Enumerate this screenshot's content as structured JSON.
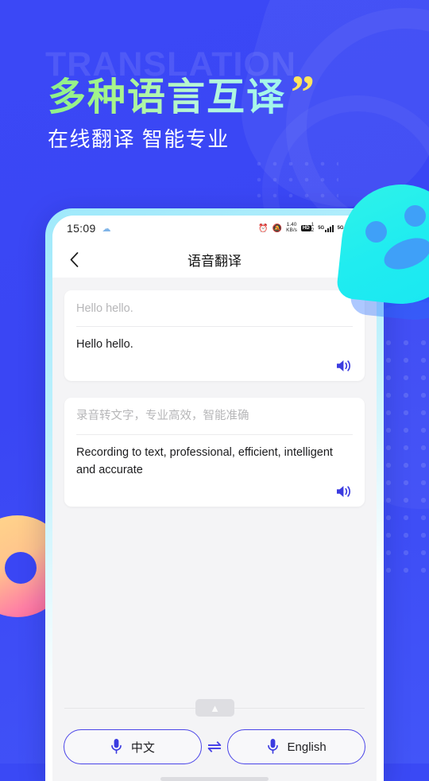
{
  "promo": {
    "watermark": "TRANSLATION",
    "headline": "多种语言互译",
    "quote_mark": "”",
    "subhead": "在线翻译 智能专业"
  },
  "phone": {
    "statusbar": {
      "time": "15:09",
      "left_icon": "cloud-sync-icon",
      "alarm_icon": "alarm-clock-icon",
      "mute_icon": "bell-muted-icon",
      "net_speed_value": "1.40",
      "net_speed_unit": "KB/s",
      "hd_badge": "HD",
      "hd_sub": "1",
      "hd_sub2": "2",
      "sim1_label": "5G",
      "sim2_label": "5G",
      "wifi_icon": "wifi-icon"
    },
    "navbar": {
      "back_icon": "chevron-left-icon",
      "title": "语音翻译"
    },
    "cards": [
      {
        "source": "Hello hello.",
        "translation": "Hello hello.",
        "speaker_icon": "speaker-icon"
      },
      {
        "source": "录音转文字，专业高效，智能准确",
        "translation": "Recording to text, professional, efficient, intelligent and accurate",
        "speaker_icon": "speaker-icon"
      }
    ],
    "collapse": {
      "icon": "chevron-double-up-icon"
    },
    "bottom": {
      "left_lang": "中文",
      "right_lang": "English",
      "left_mic_icon": "microphone-icon",
      "right_mic_icon": "microphone-icon",
      "swap_icon": "swap-arrows-icon",
      "swap_glyph": "⇌"
    }
  },
  "colors": {
    "background_blue": "#3a46f4",
    "accent_indigo": "#4a44e8",
    "headline_green": "#8cf08a",
    "quote_yellow": "#ffe45e",
    "bubble_cyan": "#2ff3e8"
  }
}
